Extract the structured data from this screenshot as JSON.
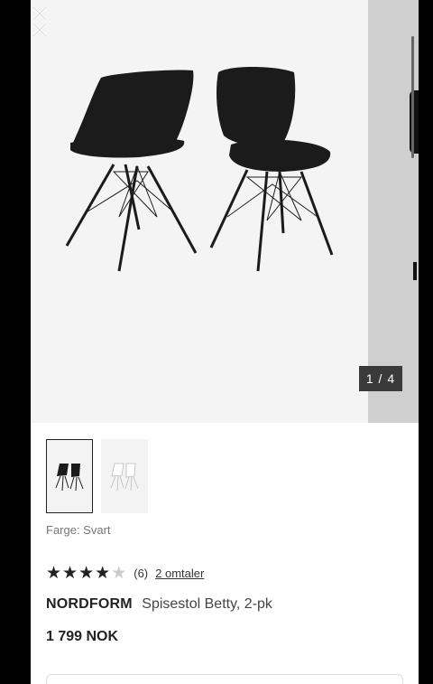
{
  "gallery": {
    "counter": "1 / 4"
  },
  "icons": {
    "close": "close-icon",
    "star": "star-icon"
  },
  "product": {
    "color_label": "Farge: Svart",
    "rating": 4,
    "rating_max": 5,
    "rating_count": "(6)",
    "reviews_link": "2 omtaler",
    "brand": "NORDFORM",
    "name": "Spisestol Betty, 2-pk",
    "price": "1 799 NOK"
  },
  "colors": {
    "background": "#f4f4f4",
    "chair_black": "#1b1b1b",
    "counter_bg": "#3a3a3a"
  }
}
